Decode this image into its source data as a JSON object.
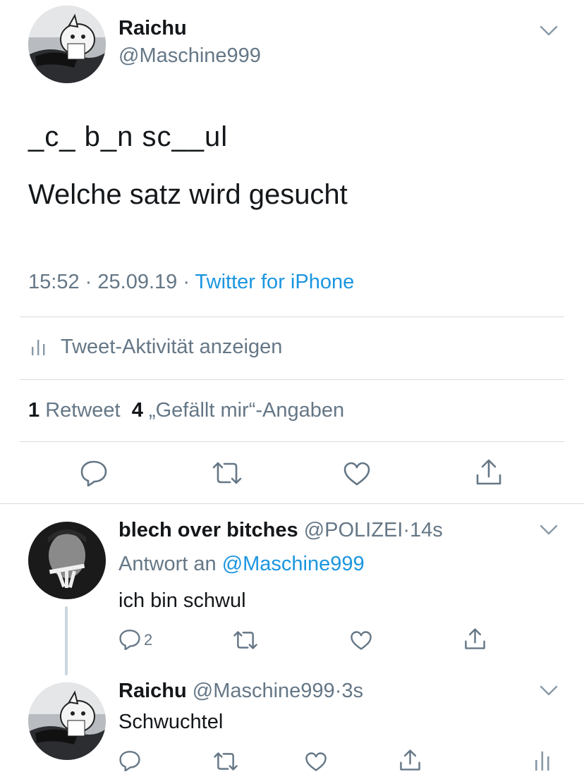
{
  "main_tweet": {
    "author_name": "Raichu",
    "handle": "@Maschine999",
    "text_line1": "_c_ b_n sc__ul",
    "text_line2": "Welche satz wird gesucht",
    "time": "15:52",
    "date": "25.09.19",
    "source": "Twitter for iPhone",
    "activity_label": "Tweet-Aktivität anzeigen",
    "retweet_count": "1",
    "retweet_label": "Retweet",
    "like_count": "4",
    "like_label": "„Gefällt mir“-Angaben"
  },
  "replies": [
    {
      "author_name": "blech over bitches",
      "handle": "@POLIZEI",
      "age": "14s",
      "reply_to_label": "Antwort an",
      "reply_to_handle": "@Maschine999",
      "text": "ich bin schwul",
      "reply_count": "2"
    },
    {
      "author_name": "Raichu",
      "handle": "@Maschine999",
      "age": "3s",
      "text": "Schwuchtel"
    }
  ],
  "separator": "·",
  "icons": {
    "chevron": "chevron-down-icon",
    "activity": "bar-chart-icon",
    "reply": "reply-icon",
    "retweet": "retweet-icon",
    "like": "heart-icon",
    "share": "share-icon"
  },
  "colors": {
    "text": "#14171a",
    "secondary": "#657786",
    "link": "#1b95e0",
    "divider": "#d7dce0"
  }
}
